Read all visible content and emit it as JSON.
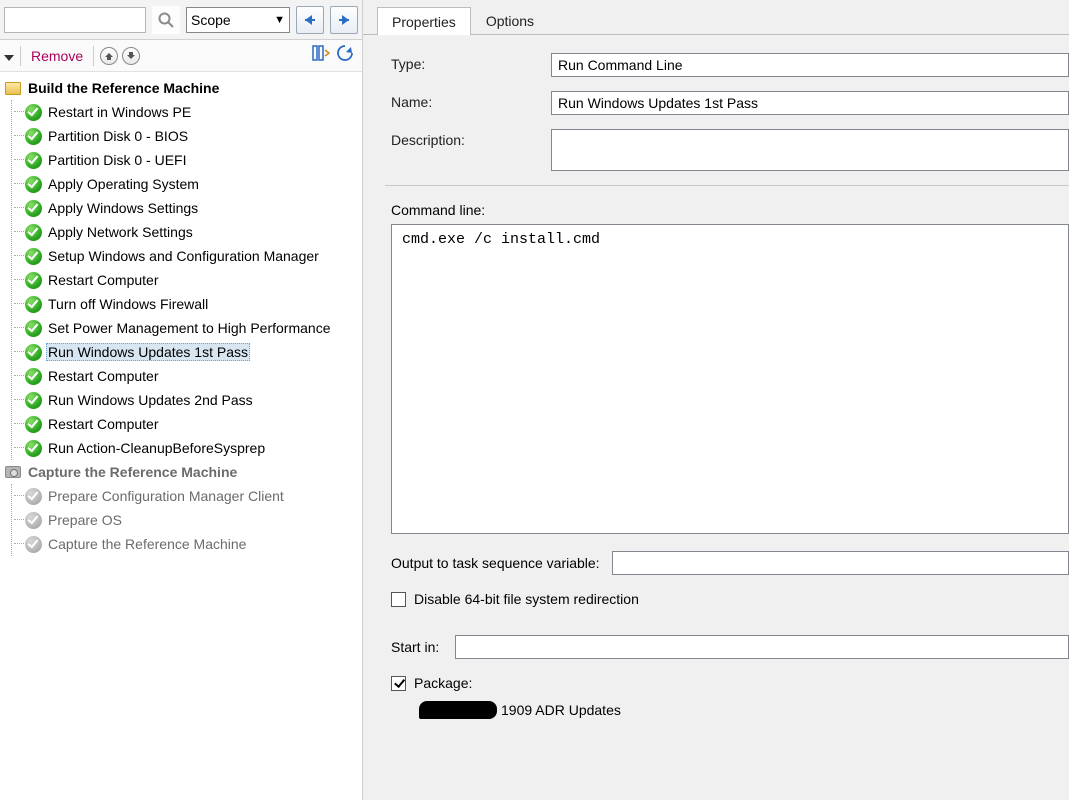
{
  "toolbar": {
    "scope_label": "Scope",
    "remove_label": "Remove"
  },
  "tree": {
    "groups": [
      {
        "name": "Build the Reference Machine",
        "icon": "folder",
        "items": [
          {
            "label": "Restart in Windows PE",
            "state": "green"
          },
          {
            "label": "Partition Disk 0 - BIOS",
            "state": "green"
          },
          {
            "label": "Partition Disk 0 - UEFI",
            "state": "green"
          },
          {
            "label": "Apply Operating System",
            "state": "green"
          },
          {
            "label": "Apply Windows Settings",
            "state": "green"
          },
          {
            "label": "Apply Network Settings",
            "state": "green"
          },
          {
            "label": "Setup Windows and Configuration Manager",
            "state": "green"
          },
          {
            "label": "Restart Computer",
            "state": "green"
          },
          {
            "label": "Turn off Windows Firewall",
            "state": "green"
          },
          {
            "label": "Set Power Management to High Performance",
            "state": "green"
          },
          {
            "label": "Run Windows Updates 1st Pass",
            "state": "green",
            "selected": true
          },
          {
            "label": "Restart Computer",
            "state": "green"
          },
          {
            "label": "Run Windows Updates 2nd Pass",
            "state": "green"
          },
          {
            "label": "Restart Computer",
            "state": "green"
          },
          {
            "label": "Run Action-CleanupBeforeSysprep",
            "state": "green"
          }
        ]
      },
      {
        "name": "Capture the Reference Machine",
        "icon": "camera",
        "greyed": true,
        "items": [
          {
            "label": "Prepare Configuration Manager Client",
            "state": "grey",
            "greyed": true
          },
          {
            "label": "Prepare OS",
            "state": "grey",
            "greyed": true
          },
          {
            "label": "Capture the Reference Machine",
            "state": "grey",
            "greyed": true
          }
        ]
      }
    ]
  },
  "tabs": {
    "properties": "Properties",
    "options": "Options",
    "active": "properties"
  },
  "properties": {
    "type_label": "Type:",
    "type_value": "Run Command Line",
    "name_label": "Name:",
    "name_value": "Run Windows Updates 1st Pass",
    "description_label": "Description:",
    "description_value": "",
    "commandline_label": "Command line:",
    "commandline_value": "cmd.exe /c install.cmd",
    "output_var_label": "Output to task sequence variable:",
    "output_var_value": "",
    "disable64_label": "Disable 64-bit file system redirection",
    "disable64_checked": false,
    "startin_label": "Start in:",
    "startin_value": "",
    "package_label": "Package:",
    "package_checked": true,
    "package_value_suffix": " 1909 ADR Updates"
  }
}
